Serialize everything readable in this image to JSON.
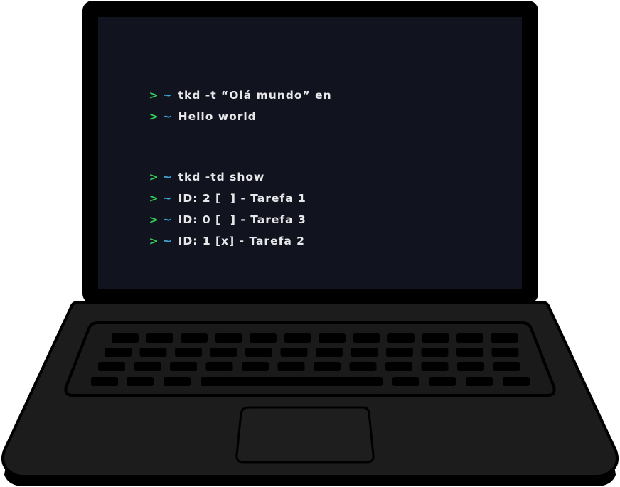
{
  "colors": {
    "screen_background": "#11141f",
    "laptop_body": "#1c1c1c",
    "outline": "#000000",
    "prompt_arrow": "#35d25a",
    "prompt_tilde": "#3fa8d8",
    "terminal_text": "#e8e8ea"
  },
  "terminal": {
    "prompt_symbol": ">",
    "prompt_path": "~",
    "lines": [
      {
        "text": "tkd -t “Olá mundo” en"
      },
      {
        "text": "Hello world"
      },
      {
        "text": "tkd -td show"
      },
      {
        "text": "ID: 2 [  ] - Tarefa 1"
      },
      {
        "text": "ID: 0 [  ] - Tarefa 3"
      },
      {
        "text": "ID: 1 [x] - Tarefa 2"
      }
    ]
  }
}
